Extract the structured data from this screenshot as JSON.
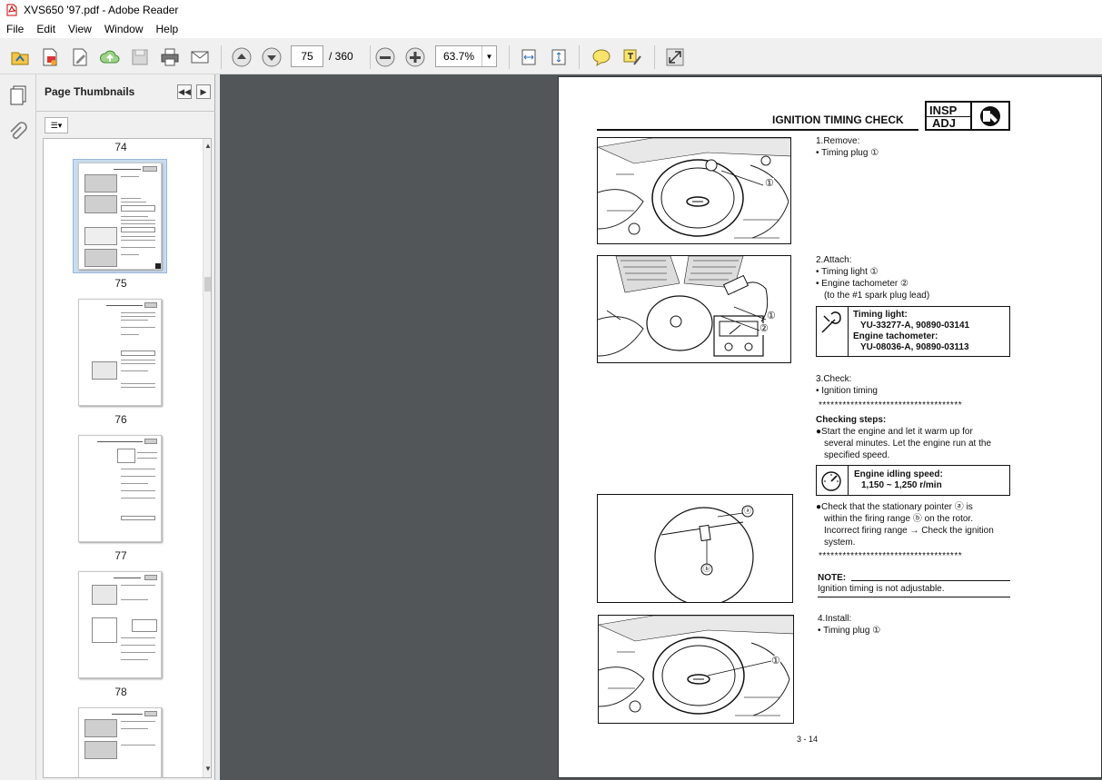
{
  "window": {
    "title": "XVS650 '97.pdf - Adobe Reader"
  },
  "menu": [
    "File",
    "Edit",
    "View",
    "Window",
    "Help"
  ],
  "toolbar": {
    "page_current": "75",
    "page_total": "/ 360",
    "zoom": "63.7%",
    "icons": [
      "open-icon",
      "create-pdf-icon",
      "edit-icon",
      "upload-icon",
      "save-icon",
      "print-icon",
      "email-icon",
      "previous-page-icon",
      "next-page-icon",
      "zoom-out-icon",
      "zoom-in-icon",
      "fit-width-icon",
      "fit-page-icon",
      "comment-icon",
      "highlight-icon",
      "expand-icon"
    ]
  },
  "panel": {
    "title": "Page Thumbnails",
    "thumbnails": [
      {
        "label": "74"
      },
      {
        "label": "75",
        "selected": true
      },
      {
        "label": "76"
      },
      {
        "label": "77"
      },
      {
        "label": "78"
      }
    ]
  },
  "document": {
    "title": "IGNITION TIMING CHECK",
    "badge_top": "INSP",
    "badge_bottom": "ADJ",
    "step1_title": "1.Remove:",
    "step1_item": "Timing plug ①",
    "step2_title": "2.Attach:",
    "step2_item1": "Timing light ①",
    "step2_item2": "Engine tachometer ②",
    "step2_item2_note": "(to the #1 spark plug lead)",
    "tool1_label": "Timing light:",
    "tool1_part": "YU-33277-A, 90890-03141",
    "tool2_label": "Engine tachometer:",
    "tool2_part": "YU-08036-A, 90890-03113",
    "step3_title": "3.Check:",
    "step3_item": "Ignition timing",
    "stars": "************************************",
    "checking_title": "Checking steps:",
    "check_a1": "●Start the engine and let it warm up for",
    "check_a2": "several minutes. Let the engine run at the",
    "check_a3": "specified speed.",
    "idle_label": "Engine idling speed:",
    "idle_value": "1,150 ~ 1,250 r/min",
    "check_b1": "●Check that the stationary pointer ⓐ is",
    "check_b2": "within the firing range ⓑ on the rotor.",
    "check_b3": "Incorrect firing range → Check the ignition",
    "check_b4": "system.",
    "note_label": "NOTE:",
    "note_text": "Ignition timing is not adjustable.",
    "step4_title": "4.Install:",
    "step4_item": "Timing plug ①",
    "callout_1": "①",
    "callout_2": "②",
    "callout_a": "ⓐ",
    "callout_b": "ⓑ",
    "page_number": "3 - 14"
  }
}
